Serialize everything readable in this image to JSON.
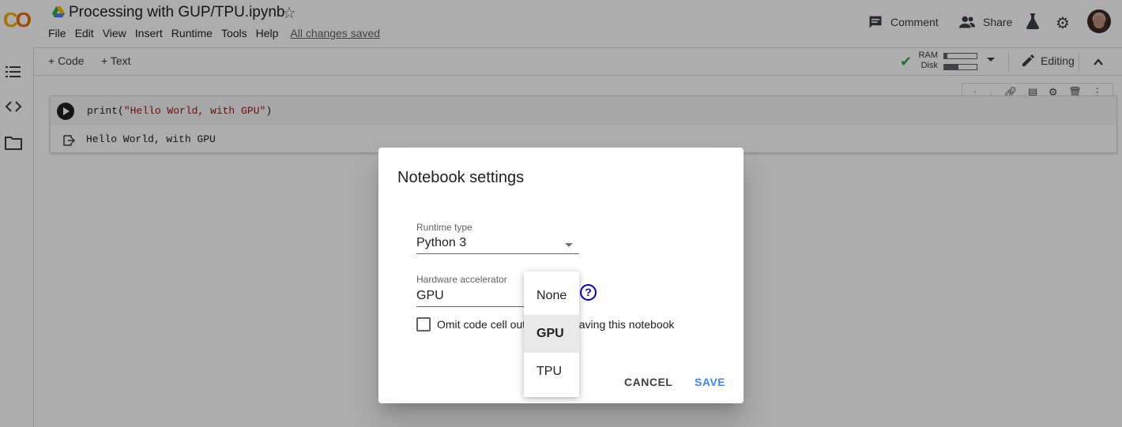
{
  "header": {
    "title": "Processing with GUP/TPU.ipynb",
    "menu": [
      "File",
      "Edit",
      "View",
      "Insert",
      "Runtime",
      "Tools",
      "Help"
    ],
    "saved_status": "All changes saved",
    "comment_label": "Comment",
    "share_label": "Share"
  },
  "toolbar": {
    "add_code": "+ Code",
    "add_text": "+ Text",
    "ram_label": "RAM",
    "disk_label": "Disk",
    "ram_usage_fraction": 0.1,
    "disk_usage_fraction": 0.45,
    "editing_label": "Editing"
  },
  "cell": {
    "code_prefix": "print(",
    "code_string": "\"Hello World, with GPU\"",
    "code_suffix": ")",
    "output": "Hello World, with GPU"
  },
  "dialog": {
    "title": "Notebook settings",
    "runtime_label": "Runtime type",
    "runtime_value": "Python 3",
    "hw_label": "Hardware accelerator",
    "hw_value": "GPU",
    "help_symbol": "?",
    "checkbox_label": "Omit code cell output when saving this notebook",
    "checkbox_checked": false,
    "cancel_label": "CANCEL",
    "save_label": "SAVE"
  },
  "dropdown": {
    "options": [
      "None",
      "GPU",
      "TPU"
    ],
    "selected": "GPU"
  },
  "colors": {
    "accent_blue": "#4285f4",
    "check_green": "#34a853",
    "logo_yellow": "#f9ab00",
    "logo_orange": "#e8710a"
  }
}
